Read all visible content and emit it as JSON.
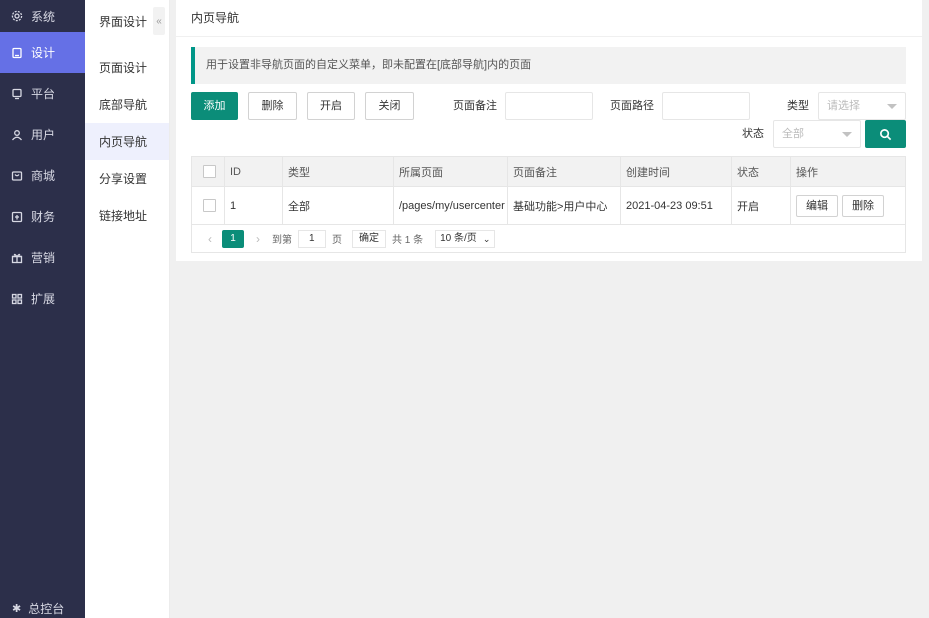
{
  "sidebar": {
    "items": [
      {
        "label": "系统",
        "icon": "gear-icon"
      },
      {
        "label": "设计",
        "icon": "design-icon",
        "active": true
      },
      {
        "label": "平台",
        "icon": "platform-icon"
      },
      {
        "label": "用户",
        "icon": "user-icon"
      },
      {
        "label": "商城",
        "icon": "mall-icon"
      },
      {
        "label": "财务",
        "icon": "finance-icon"
      },
      {
        "label": "营销",
        "icon": "gift-icon"
      },
      {
        "label": "扩展",
        "icon": "grid-icon"
      }
    ],
    "bottom": {
      "label": "总控台",
      "icon": "console-icon"
    }
  },
  "submenu": {
    "title": "界面设计",
    "collapse_icon": "double-chevron-left-icon",
    "items": [
      {
        "label": "页面设计"
      },
      {
        "label": "底部导航"
      },
      {
        "label": "内页导航",
        "active": true
      },
      {
        "label": "分享设置"
      },
      {
        "label": "链接地址"
      }
    ]
  },
  "main": {
    "title": "内页导航",
    "tip": "用于设置非导航页面的自定义菜单，即未配置在[底部导航]内的页面",
    "toolbar": {
      "add": "添加",
      "delete": "删除",
      "enable": "开启",
      "disable": "关闭"
    },
    "filters": {
      "remark_label": "页面备注",
      "remark_value": "",
      "path_label": "页面路径",
      "path_value": "",
      "type_label": "类型",
      "type_placeholder": "请选择",
      "status_label": "状态",
      "status_value": "全部"
    },
    "table": {
      "headers": [
        "",
        "ID",
        "类型",
        "所属页面",
        "页面备注",
        "创建时间",
        "状态",
        "操作"
      ],
      "rows": [
        {
          "id": "1",
          "type": "全部",
          "page": "/pages/my/usercenter",
          "remark": "基础功能>用户中心",
          "created": "2021-04-23 09:51",
          "status": "开启",
          "actions": [
            "编辑",
            "删除"
          ]
        }
      ]
    },
    "pager": {
      "current": "1",
      "goto_label": "到第",
      "goto_value": "1",
      "page_unit": "页",
      "confirm": "确定",
      "total": "共 1 条",
      "page_size": "10 条/页"
    }
  },
  "colors": {
    "sidebar_bg": "#2c2f4a",
    "sidebar_active": "#6570e6",
    "primary": "#0b8d79"
  }
}
